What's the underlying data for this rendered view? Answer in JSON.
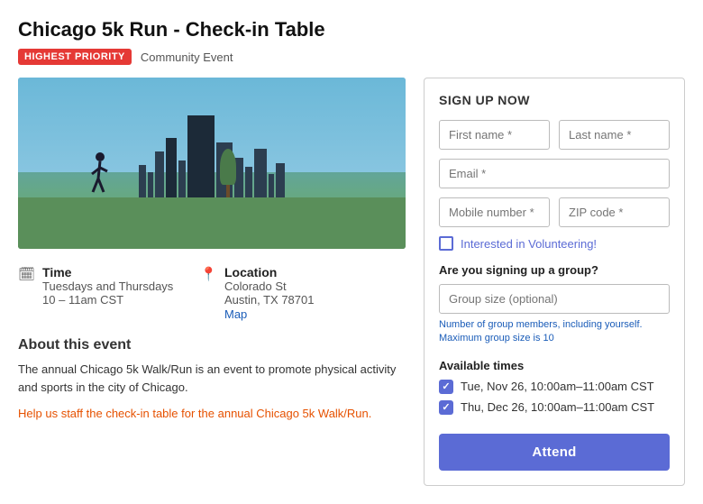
{
  "page": {
    "title": "Chicago 5k Run - Check-in Table",
    "badge_priority": "HIGHEST PRIORITY",
    "badge_type": "Community Event"
  },
  "event": {
    "time_label": "Time",
    "time_days": "Tuesdays and Thursdays",
    "time_hours": "10 – 11am CST",
    "location_label": "Location",
    "location_address": "Colorado St",
    "location_city": "Austin, TX 78701",
    "map_link": "Map",
    "about_title": "About this event",
    "about_text": "The annual Chicago 5k Walk/Run is an event to promote physical activity and sports in the city of Chicago.",
    "about_highlight": "Help us staff the check-in table for the annual Chicago 5k Walk/Run."
  },
  "signup": {
    "section_title": "SIGN UP NOW",
    "first_name_placeholder": "First name *",
    "last_name_placeholder": "Last name *",
    "email_placeholder": "Email *",
    "mobile_placeholder": "Mobile number *",
    "zip_placeholder": "ZIP code *",
    "volunteering_label": "Interested in Volunteering!",
    "group_section_title": "Are you signing up a group?",
    "group_size_placeholder": "Group size (optional)",
    "group_hint_line1": "Number of group members, including yourself.",
    "group_hint_line2": "Maximum group size is 10",
    "available_times_title": "Available times",
    "time_option_1": "Tue, Nov 26, 10:00am–11:00am CST",
    "time_option_2": "Thu, Dec 26, 10:00am–11:00am CST",
    "attend_button": "Attend"
  },
  "icons": {
    "time_icon": "🗓",
    "location_icon": "📍"
  }
}
